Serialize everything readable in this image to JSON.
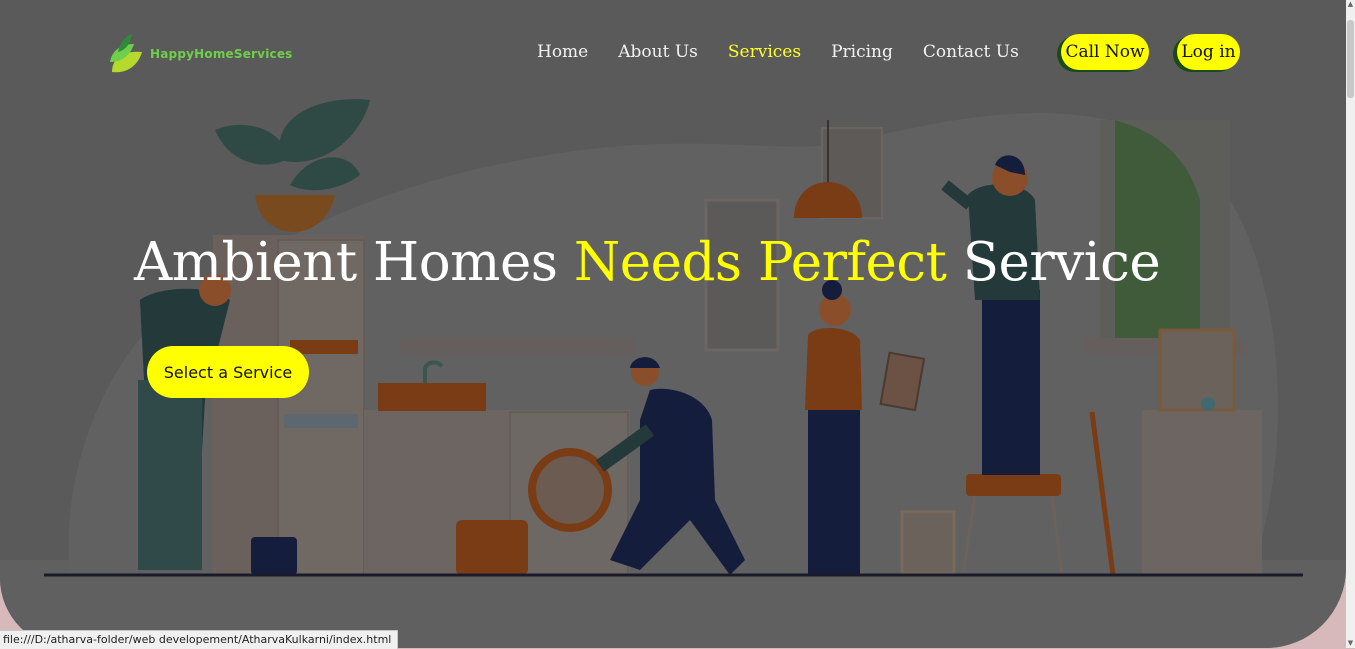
{
  "brand": {
    "name": "HappyHomeServices"
  },
  "nav": {
    "items": [
      {
        "label": "Home"
      },
      {
        "label": "About Us"
      },
      {
        "label": "Services",
        "active": true
      },
      {
        "label": "Pricing"
      },
      {
        "label": "Contact Us"
      }
    ],
    "call_now": "Call Now",
    "login": "Log in"
  },
  "hero": {
    "headline_part1": "Ambient Homes ",
    "headline_highlight": "Needs Perfect",
    "headline_part2": " Service",
    "cta": "Select a Service"
  },
  "status_bar": {
    "url": "file:///D:/atharva-folder/web developement/AtharvaKulkarni/index.html"
  },
  "colors": {
    "accent": "#ffff00",
    "brand_green": "#6fcf4a",
    "overlay": "#5a5a5a",
    "page_bg": "#d8b9bb"
  }
}
